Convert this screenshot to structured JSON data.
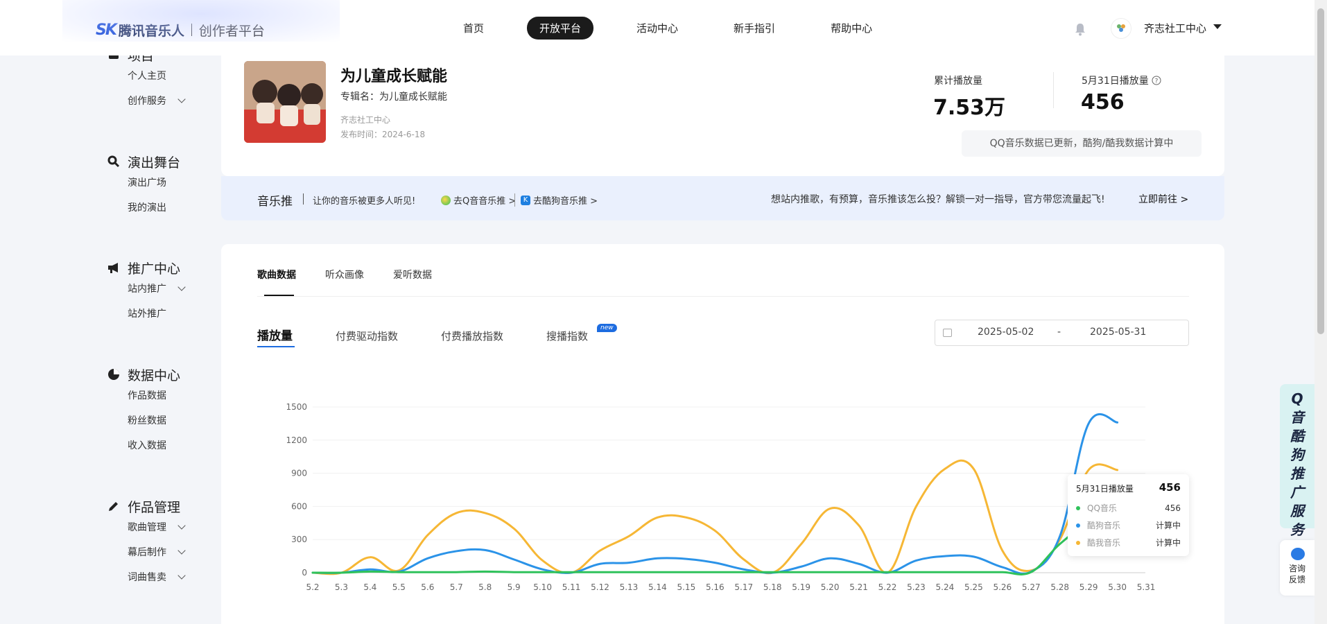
{
  "header": {
    "logo_mark": "SK",
    "logo_text": "腾讯音乐人",
    "logo_sub": "创作者平台",
    "nav": [
      "首页",
      "开放平台",
      "活动中心",
      "新手指引",
      "帮助中心"
    ],
    "active_nav": 1,
    "user_name": "齐志社工中心"
  },
  "sidebar": {
    "groups": [
      {
        "title": "项目",
        "items": [
          {
            "label": "个人主页",
            "expand": false
          },
          {
            "label": "创作服务",
            "expand": true
          }
        ]
      },
      {
        "title": "演出舞台",
        "items": [
          {
            "label": "演出广场",
            "expand": false
          },
          {
            "label": "我的演出",
            "expand": false
          }
        ]
      },
      {
        "title": "推广中心",
        "items": [
          {
            "label": "站内推广",
            "expand": true
          },
          {
            "label": "站外推广",
            "expand": false
          }
        ]
      },
      {
        "title": "数据中心",
        "items": [
          {
            "label": "作品数据",
            "expand": false
          },
          {
            "label": "粉丝数据",
            "expand": false
          },
          {
            "label": "收入数据",
            "expand": false
          }
        ]
      },
      {
        "title": "作品管理",
        "items": [
          {
            "label": "歌曲管理",
            "expand": true
          },
          {
            "label": "幕后制作",
            "expand": true
          },
          {
            "label": "词曲售卖",
            "expand": true
          }
        ]
      }
    ]
  },
  "song": {
    "title": "为儿童成长赋能",
    "album": "专辑名：为儿童成长赋能",
    "artist": "齐志社工中心",
    "publish": "发布时间：2024-6-18"
  },
  "stats": {
    "total_label": "累计播放量",
    "total_value": "7.53万",
    "day_label": "5月31日播放量",
    "day_value": "456",
    "notice": "QQ音乐数据已更新，酷狗/酷我数据计算中"
  },
  "promo": {
    "title": "音乐推",
    "subtitle": "让你的音乐被更多人听见!",
    "link_qq": "去Q音音乐推 >",
    "link_kugou": "去酷狗音乐推 >",
    "right_text": "想站内推歌，有预算，音乐推该怎么投？解锁一对一指导，官方带您流量起飞!",
    "go": "立即前往 >"
  },
  "tabs": {
    "primary": [
      "歌曲数据",
      "听众画像",
      "爱听数据"
    ],
    "secondary": [
      "播放量",
      "付费驱动指数",
      "付费播放指数",
      "搜播指数"
    ],
    "new_badge": "new"
  },
  "date_range": {
    "from": "2025-05-02",
    "dash": "-",
    "to": "2025-05-31"
  },
  "chart_data": {
    "type": "line",
    "x": [
      "5.2",
      "5.3",
      "5.4",
      "5.5",
      "5.6",
      "5.7",
      "5.8",
      "5.9",
      "5.10",
      "5.11",
      "5.12",
      "5.13",
      "5.14",
      "5.15",
      "5.16",
      "5.17",
      "5.18",
      "5.19",
      "5.20",
      "5.21",
      "5.22",
      "5.23",
      "5.24",
      "5.25",
      "5.26",
      "5.27",
      "5.28",
      "5.29",
      "5.30",
      "5.31"
    ],
    "yticks": [
      0,
      300,
      600,
      900,
      1200,
      1500
    ],
    "ylim": [
      0,
      1500
    ],
    "grid": true,
    "series": [
      {
        "name": "QQ音乐",
        "color": "#2fc25b",
        "values": [
          0,
          0,
          10,
          5,
          5,
          5,
          10,
          5,
          5,
          5,
          5,
          5,
          5,
          5,
          5,
          5,
          5,
          5,
          5,
          5,
          5,
          5,
          5,
          5,
          5,
          5,
          260,
          440,
          456,
          456
        ]
      },
      {
        "name": "酷狗音乐",
        "color": "#2b93e8",
        "values": [
          0,
          0,
          30,
          10,
          130,
          195,
          205,
          120,
          30,
          0,
          80,
          90,
          130,
          125,
          90,
          30,
          0,
          55,
          130,
          80,
          0,
          110,
          150,
          145,
          50,
          10,
          330,
          1350,
          1360,
          null
        ]
      },
      {
        "name": "酷我音乐",
        "color": "#f6b735",
        "values": [
          0,
          0,
          140,
          20,
          340,
          540,
          540,
          400,
          110,
          0,
          200,
          330,
          500,
          500,
          380,
          120,
          0,
          260,
          580,
          430,
          0,
          600,
          940,
          940,
          200,
          20,
          300,
          930,
          930,
          null
        ]
      }
    ]
  },
  "tooltip": {
    "title": "5月31日播放量",
    "value": "456",
    "rows": [
      {
        "name": "QQ音乐",
        "value": "456",
        "color": "#2fc25b"
      },
      {
        "name": "酷狗音乐",
        "value": "计算中",
        "color": "#2b93e8"
      },
      {
        "name": "酷我音乐",
        "value": "计算中",
        "color": "#f6b735"
      }
    ]
  },
  "float": {
    "promo_service": "Q音酷狗推广服务",
    "consult": "咨询反馈"
  }
}
